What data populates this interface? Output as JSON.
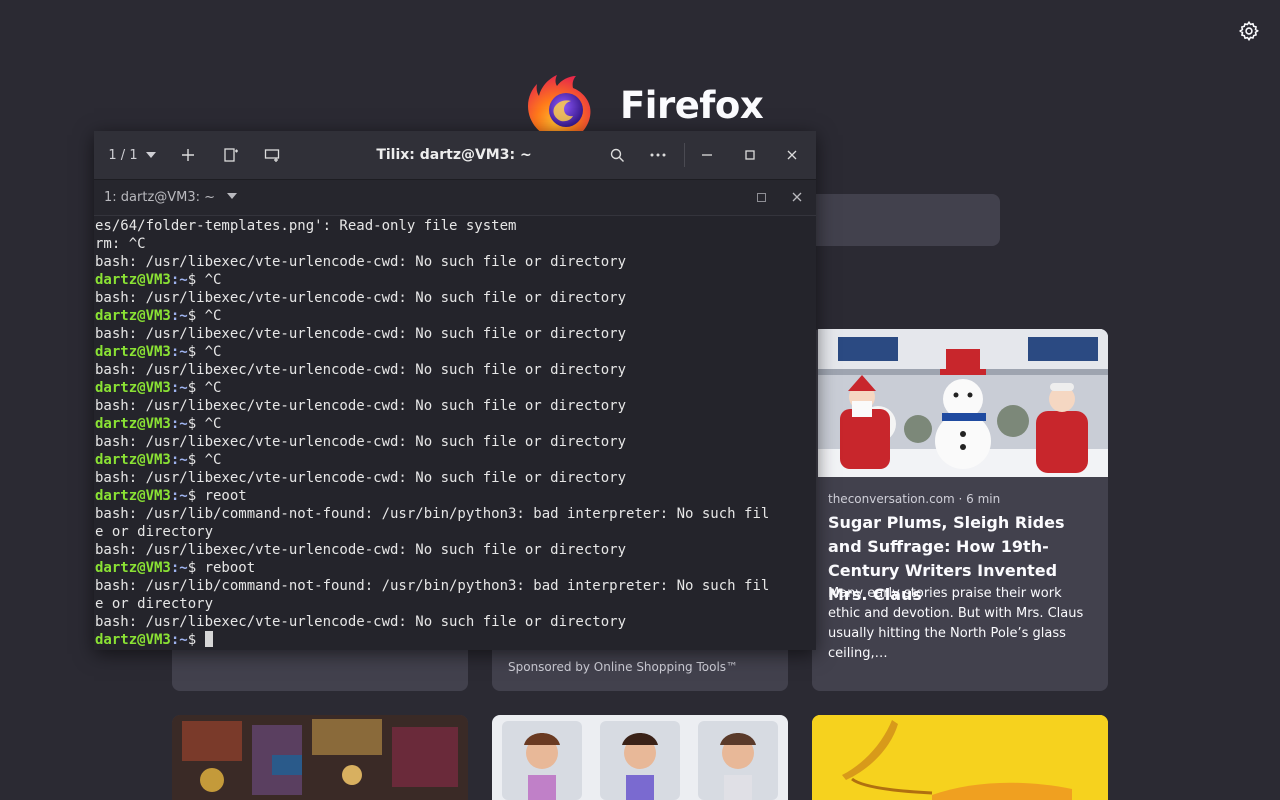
{
  "brand": {
    "name": "Firefox"
  },
  "icons": {
    "settings": "gear-icon",
    "logo": "firefox-logo-icon"
  },
  "cards": [
    {
      "source": "theconversation.com · 6 min",
      "title": "Sugar Plums, Sleigh Rides and Suffrage: How 19th-Century Writers Invented Mrs. Claus",
      "excerpt": "Many early stories praise their work ethic and devotion. But with Mrs. Claus usually hitting the North Pole’s glass ceiling,…"
    }
  ],
  "sponsored": {
    "label": "Sponsored by Online Shopping Tools™"
  },
  "tilix": {
    "session_counter": "1 / 1",
    "title": "Tilix: dartz@VM3: ~",
    "terminal_tab": "1: dartz@VM3: ~",
    "prompt_user": "dartz@VM3",
    "prompt_path": ":~",
    "lines": [
      {
        "t": "out",
        "text": "es/64/folder-templates.png': Read-only file system"
      },
      {
        "t": "out",
        "text": "rm: ^C"
      },
      {
        "t": "out",
        "text": "bash: /usr/libexec/vte-urlencode-cwd: No such file or directory"
      },
      {
        "t": "cmd",
        "text": "$ ^C"
      },
      {
        "t": "out",
        "text": "bash: /usr/libexec/vte-urlencode-cwd: No such file or directory"
      },
      {
        "t": "cmd",
        "text": "$ ^C"
      },
      {
        "t": "out",
        "text": "bash: /usr/libexec/vte-urlencode-cwd: No such file or directory"
      },
      {
        "t": "cmd",
        "text": "$ ^C"
      },
      {
        "t": "out",
        "text": "bash: /usr/libexec/vte-urlencode-cwd: No such file or directory"
      },
      {
        "t": "cmd",
        "text": "$ ^C"
      },
      {
        "t": "out",
        "text": "bash: /usr/libexec/vte-urlencode-cwd: No such file or directory"
      },
      {
        "t": "cmd",
        "text": "$ ^C"
      },
      {
        "t": "out",
        "text": "bash: /usr/libexec/vte-urlencode-cwd: No such file or directory"
      },
      {
        "t": "cmd",
        "text": "$ ^C"
      },
      {
        "t": "out",
        "text": "bash: /usr/libexec/vte-urlencode-cwd: No such file or directory"
      },
      {
        "t": "cmd",
        "text": "$ reoot"
      },
      {
        "t": "out",
        "text": "bash: /usr/lib/command-not-found: /usr/bin/python3: bad interpreter: No such fil"
      },
      {
        "t": "out",
        "text": "e or directory"
      },
      {
        "t": "out",
        "text": "bash: /usr/libexec/vte-urlencode-cwd: No such file or directory"
      },
      {
        "t": "cmd",
        "text": "$ reboot"
      },
      {
        "t": "out",
        "text": "bash: /usr/lib/command-not-found: /usr/bin/python3: bad interpreter: No such fil"
      },
      {
        "t": "out",
        "text": "e or directory"
      },
      {
        "t": "out",
        "text": "bash: /usr/libexec/vte-urlencode-cwd: No such file or directory"
      },
      {
        "t": "cmd",
        "text": "$ ",
        "cursor": true
      }
    ]
  }
}
